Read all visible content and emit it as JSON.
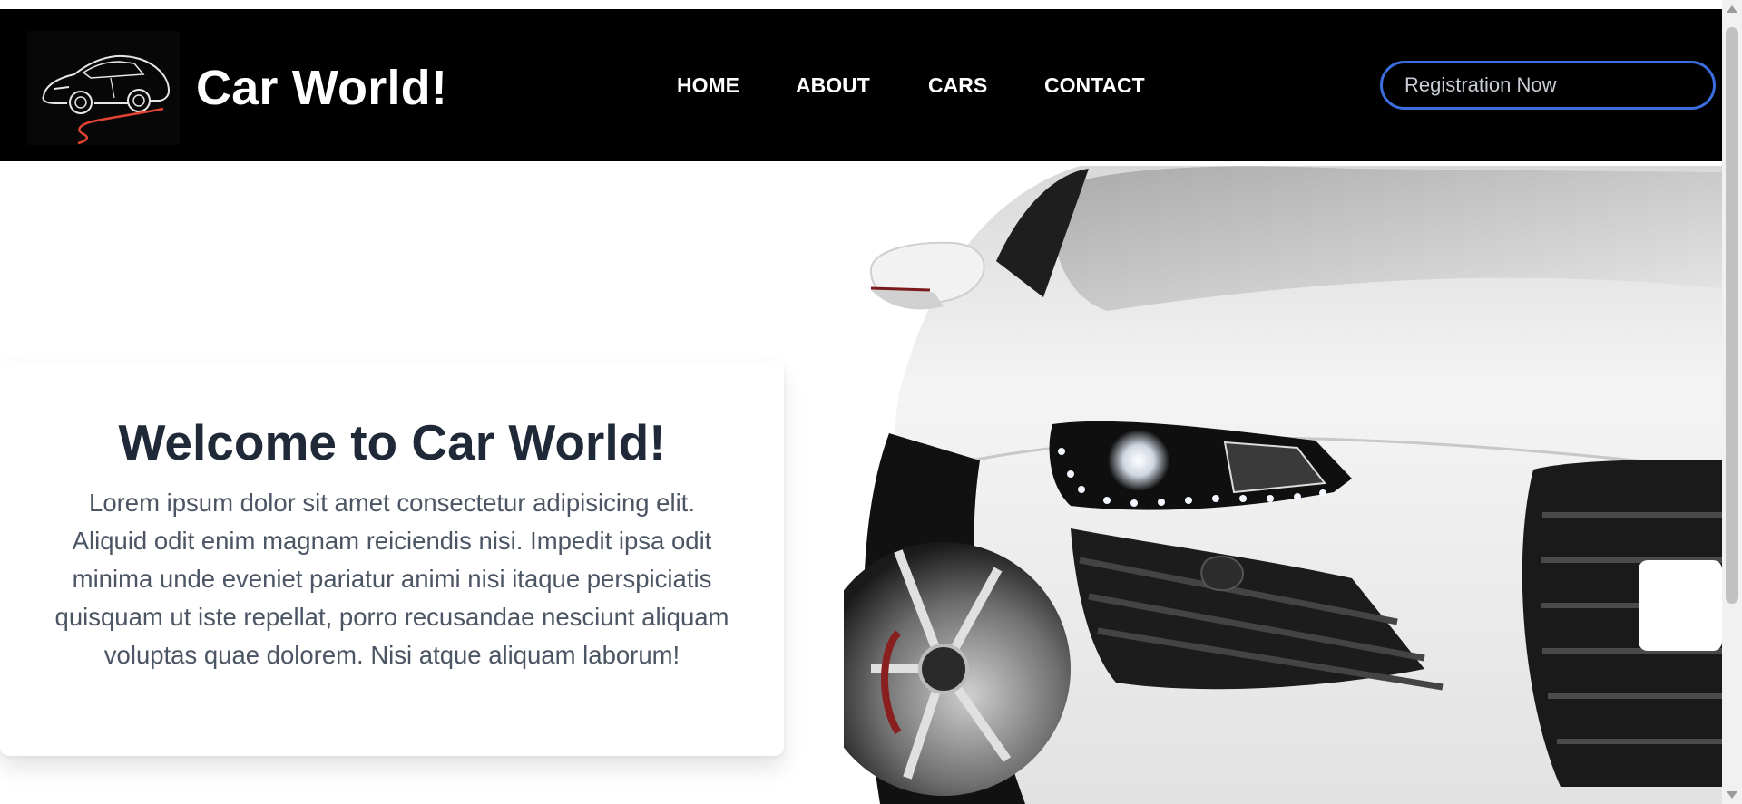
{
  "header": {
    "brand": "Car World!",
    "nav": [
      "HOME",
      "ABOUT",
      "CARS",
      "CONTACT"
    ],
    "register_placeholder": "Registration Now"
  },
  "hero": {
    "title": "Welcome to Car World!",
    "text": "Lorem ipsum dolor sit amet consectetur adipisicing elit. Aliquid odit enim magnam reiciendis nisi. Impedit ipsa odit minima unde eveniet pariatur animi nisi itaque perspiciatis quisquam ut iste repellat, porro recusandae nesciunt aliquam voluptas quae dolorem. Nisi atque aliquam laborum!"
  },
  "colors": {
    "navbar_bg": "#000000",
    "accent_border": "#3b6ee0",
    "heading": "#1f2937",
    "body_text": "#4b5563",
    "logo_stroke": "#e34234"
  },
  "icons": {
    "logo": "car-outline-logo-icon",
    "hero_image": "white-sports-car-image"
  }
}
